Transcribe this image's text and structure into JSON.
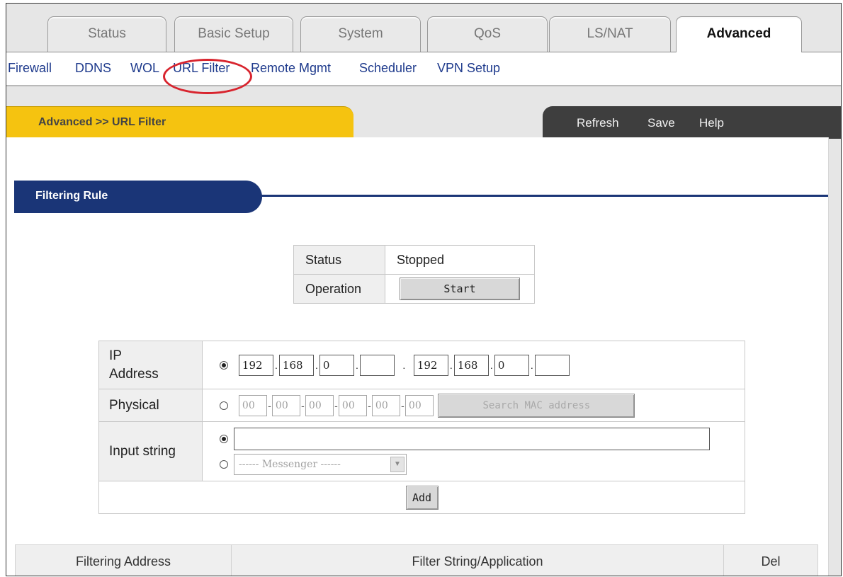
{
  "tabs": [
    {
      "label": "Status",
      "active": false
    },
    {
      "label": "Basic Setup",
      "active": false
    },
    {
      "label": "System",
      "active": false
    },
    {
      "label": "QoS",
      "active": false
    },
    {
      "label": "LS/NAT",
      "active": false
    },
    {
      "label": "Advanced",
      "active": true
    }
  ],
  "subnav": [
    {
      "label": "Firewall"
    },
    {
      "label": "DDNS"
    },
    {
      "label": "WOL"
    },
    {
      "label": "URL Filter",
      "highlighted": true
    },
    {
      "label": "Remote Mgmt"
    },
    {
      "label": "Scheduler"
    },
    {
      "label": "VPN Setup"
    }
  ],
  "breadcrumb": "Advanced >> URL Filter",
  "actions": {
    "refresh": "Refresh",
    "save": "Save",
    "help": "Help"
  },
  "section_title": "Filtering Rule",
  "status_panel": {
    "status_label": "Status",
    "status_value": "Stopped",
    "operation_label": "Operation",
    "start_button": "Start"
  },
  "rule_form": {
    "ip_label": "IP Address",
    "ip_start": [
      "192",
      "168",
      "0",
      ""
    ],
    "ip_end": [
      "192",
      "168",
      "0",
      ""
    ],
    "ip_selected": true,
    "physical_label": "Physical",
    "mac": [
      "00",
      "00",
      "00",
      "00",
      "00",
      "00"
    ],
    "physical_selected": false,
    "search_mac_button": "Search MAC address",
    "input_label": "Input string",
    "input_value": "",
    "string_selected": true,
    "messenger_option": "------ Messenger ------",
    "messenger_selected": false,
    "add_button": "Add"
  },
  "result_table": {
    "headers": [
      "Filtering Address",
      "Filter String/Application",
      "Del"
    ]
  },
  "colors": {
    "nav_link": "#1e3a8c",
    "breadcrumb_tab": "#f5c310",
    "action_tab": "#3e3e3e",
    "section_bar": "#1a3577",
    "highlight_ring": "#d8242e"
  }
}
